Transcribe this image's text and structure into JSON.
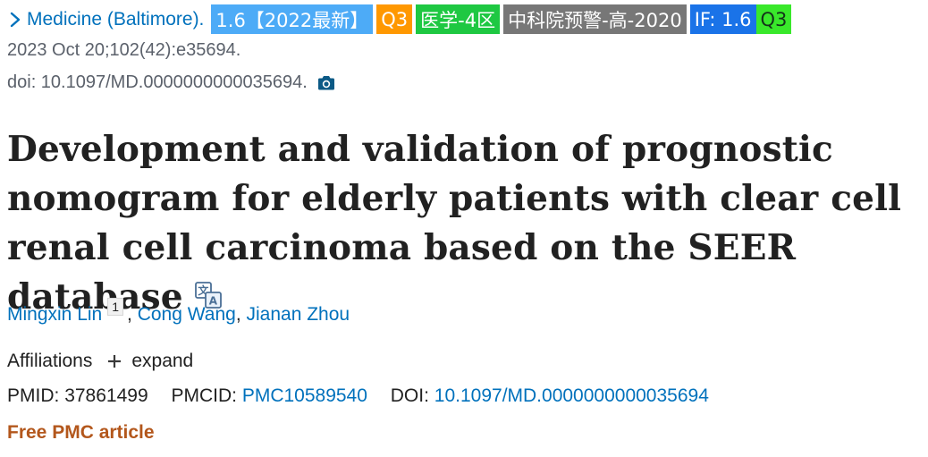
{
  "journal": {
    "name": "Medicine (Baltimore).",
    "badges": {
      "if_year": "1.6【2022最新】",
      "quartile_1": "Q3",
      "cas_zone": "医学-4区",
      "warning": "中科院预警-高-2020",
      "impact_factor": "IF: 1.6",
      "quartile_2": "Q3"
    },
    "colors": {
      "link": "#0071bc",
      "badge_if_year": "#4dabf7",
      "badge_q3_orange": "#ff9800",
      "badge_cas": "#1ec842",
      "badge_warning": "#777777",
      "badge_if": "#1a73e8",
      "badge_q3_green": "#39e82b"
    }
  },
  "citation": "2023 Oct 20;102(42):e35694.",
  "doi_line": "doi: 10.1097/MD.0000000000035694.",
  "title": "Development and validation of prognostic nomogram for elderly patients with clear cell renal cell carcinoma based on the SEER database",
  "authors": [
    {
      "name": "Mingxin Lin",
      "affiliation": "1"
    },
    {
      "name": "Cong Wang"
    },
    {
      "name": "Jianan Zhou"
    }
  ],
  "author_separator": ", ",
  "affiliations": {
    "label": "Affiliations",
    "expand_label": "expand"
  },
  "identifiers": {
    "pmid_label": "PMID:",
    "pmid": "37861499",
    "pmcid_label": "PMCID:",
    "pmcid": "PMC10589540",
    "doi_label": "DOI:",
    "doi": "10.1097/MD.0000000000035694"
  },
  "free_pmc_label": "Free PMC article",
  "icons": {
    "journal_chevron": "chevron-right-icon",
    "camera": "camera-icon",
    "translate": "translate-icon",
    "expand": "plus-icon"
  }
}
